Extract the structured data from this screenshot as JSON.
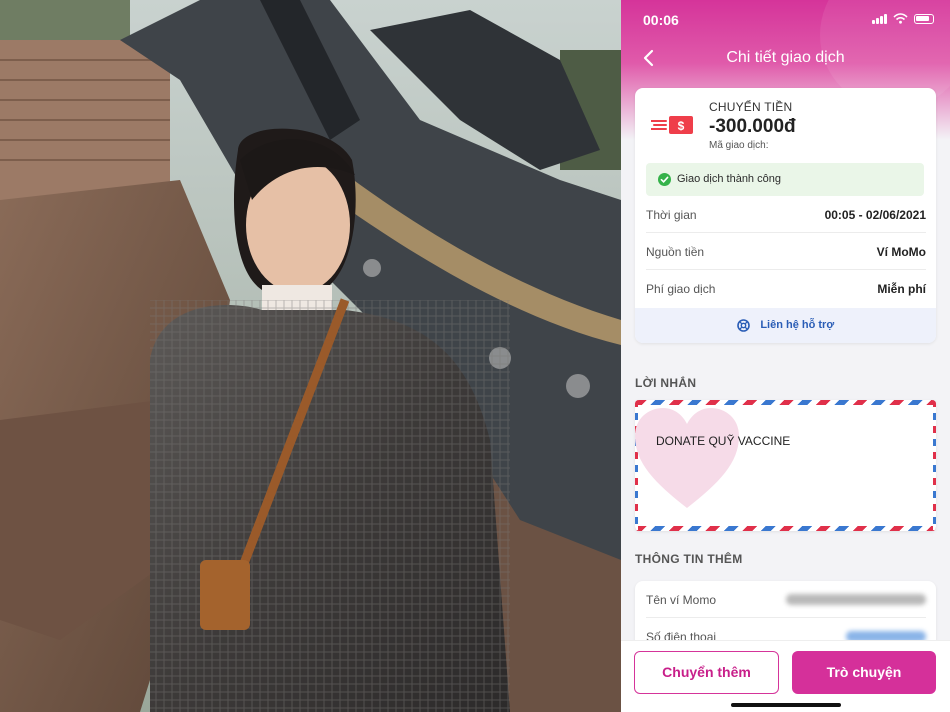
{
  "status_bar": {
    "time": "00:06"
  },
  "nav": {
    "title": "Chi tiết giao dịch",
    "back_icon": "chevron-left-icon"
  },
  "transaction": {
    "type": "CHUYỂN TIỀN",
    "amount": "-300.000đ",
    "code_label": "Mã giao dịch:",
    "status": "Giao dịch thành công",
    "rows": [
      {
        "label": "Thời gian",
        "value": "00:05 - 02/06/2021"
      },
      {
        "label": "Nguồn tiền",
        "value": "Ví MoMo"
      },
      {
        "label": "Phí giao dịch",
        "value": "Miễn phí"
      }
    ],
    "support_label": "Liên hệ hỗ trợ"
  },
  "message": {
    "section_title": "LỜI NHẮN",
    "text": "DONATE QUỸ VACCINE"
  },
  "extra_info": {
    "section_title": "THÔNG TIN THÊM",
    "rows": [
      {
        "label": "Tên ví Momo"
      },
      {
        "label": "Số điện thoại"
      }
    ]
  },
  "actions": {
    "transfer_more": "Chuyển thêm",
    "chat": "Trò chuyện"
  },
  "colors": {
    "brand": "#d5309a",
    "success_bg": "#eaf6e8",
    "link": "#2a5db6"
  }
}
